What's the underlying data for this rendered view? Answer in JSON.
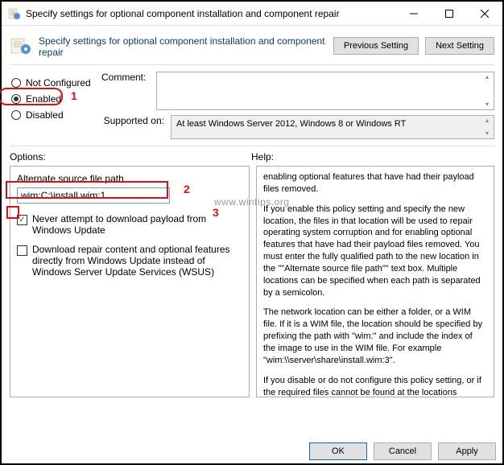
{
  "window": {
    "title": "Specify settings for optional component installation and component repair"
  },
  "header": {
    "title": "Specify settings for optional component installation and component repair",
    "prev_btn": "Previous Setting",
    "next_btn": "Next Setting"
  },
  "radios": {
    "not_configured": "Not Configured",
    "enabled": "Enabled",
    "disabled": "Disabled",
    "selected": "enabled"
  },
  "comment": {
    "label": "Comment:",
    "value": ""
  },
  "supported": {
    "label": "Supported on:",
    "value": "At least Windows Server 2012, Windows 8 or Windows RT"
  },
  "options_label": "Options:",
  "help_label": "Help:",
  "options": {
    "alt_path_label": "Alternate source file path",
    "alt_path_value": "wim:C:\\install.wim:1",
    "chk1_label": "Never attempt to download payload from Windows Update",
    "chk1_checked": true,
    "chk2_label": "Download repair content and optional features directly from Windows Update instead of Windows Server Update Services (WSUS)",
    "chk2_checked": false
  },
  "help_text": {
    "p1": "enabling optional features that have had their payload files removed.",
    "p2": "If you enable this policy setting and specify the new location, the files in that location will be used to repair operating system corruption and for enabling optional features that have had their payload files removed. You must enter the fully qualified path to the new location in the \"\"Alternate source file path\"\" text box. Multiple locations can be specified when each path is separated by a semicolon.",
    "p3": "The network location can be either a folder, or a WIM file. If it is a WIM file, the location should be specified by prefixing the path with \"wim:\" and include the index of the image to use in the WIM file. For example \"wim:\\\\server\\share\\install.wim:3\".",
    "p4": "If you disable or do not configure this policy setting, or if the required files cannot be found at the locations specified in this policy setting, the files will be downloaded from Windows Update, if that is allowed by the policy settings for the computer."
  },
  "footer": {
    "ok": "OK",
    "cancel": "Cancel",
    "apply": "Apply"
  },
  "annotations": {
    "n1": "1",
    "n2": "2",
    "n3": "3"
  },
  "watermark": "www.wintips.org"
}
